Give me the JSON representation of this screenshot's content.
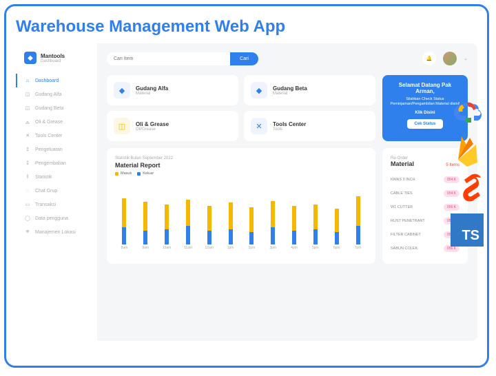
{
  "page_title": "Warehouse Management Web App",
  "app": {
    "name": "Mantools",
    "subtitle": "Dashboard"
  },
  "search": {
    "placeholder": "Cari Item",
    "button": "Cari"
  },
  "sidebar": {
    "items": [
      {
        "label": "Dashboard",
        "active": true
      },
      {
        "label": "Gudang Alfa"
      },
      {
        "label": "Gudang Beta"
      },
      {
        "label": "Oli & Grease"
      },
      {
        "label": "Tools Center"
      },
      {
        "label": "Pengeluaran"
      },
      {
        "label": "Pengembalian"
      },
      {
        "label": "Statistik"
      },
      {
        "label": "Chat Grup"
      },
      {
        "label": "Transaksi"
      },
      {
        "label": "Data pengguna"
      },
      {
        "label": "Manajemen Lokasi"
      }
    ]
  },
  "tiles": [
    {
      "title": "Gudang Alfa",
      "subtitle": "Material"
    },
    {
      "title": "Gudang Beta",
      "subtitle": "Material"
    },
    {
      "title": "Oli & Grease",
      "subtitle": "Oil/Grease"
    },
    {
      "title": "Tools Center",
      "subtitle": "Tools"
    }
  ],
  "welcome": {
    "greeting": "Selamat Datang Pak Arman,",
    "body": "Silahkan Check Status Peminjaman/Pengambilan Material disini!",
    "klik": "Klik Disini",
    "button": "Cek Status"
  },
  "report": {
    "subtitle": "Statistik Bulan September 2022",
    "title": "Material Report",
    "legend": [
      "Masuk",
      "Keluar"
    ]
  },
  "reorder": {
    "subtitle": "Re-Order",
    "title": "Material",
    "count": "5 Items",
    "items": [
      {
        "name": "KWAS 3 INCH",
        "badge": "054 K"
      },
      {
        "name": "CABLE TIES",
        "badge": "054 K"
      },
      {
        "name": "W1 CUTTER",
        "badge": "056 K"
      },
      {
        "name": "RUST PENETRANT",
        "badge": "054 K"
      },
      {
        "name": "FILTER CABINET",
        "badge": "054 K"
      },
      {
        "name": "SABUN COLEK",
        "badge": "056 K"
      }
    ]
  },
  "chart_data": {
    "type": "bar",
    "title": "Material Report",
    "xlabel": "",
    "ylabel": "",
    "categories": [
      "8am",
      "9am",
      "10am",
      "11am",
      "12am",
      "1pm",
      "2pm",
      "3pm",
      "4pm",
      "5pm",
      "6pm",
      "7pm"
    ],
    "series": [
      {
        "name": "Masuk",
        "color": "#f5b700",
        "values": [
          60,
          55,
          52,
          58,
          50,
          54,
          48,
          56,
          50,
          52,
          46,
          62
        ]
      },
      {
        "name": "Keluar",
        "color": "#2F80ED",
        "values": [
          22,
          18,
          20,
          24,
          18,
          20,
          16,
          22,
          18,
          20,
          16,
          24
        ]
      }
    ],
    "ylim": [
      0,
      80
    ]
  },
  "techstack": [
    "Google Cloud",
    "Firebase",
    "Svelte",
    "TypeScript"
  ]
}
